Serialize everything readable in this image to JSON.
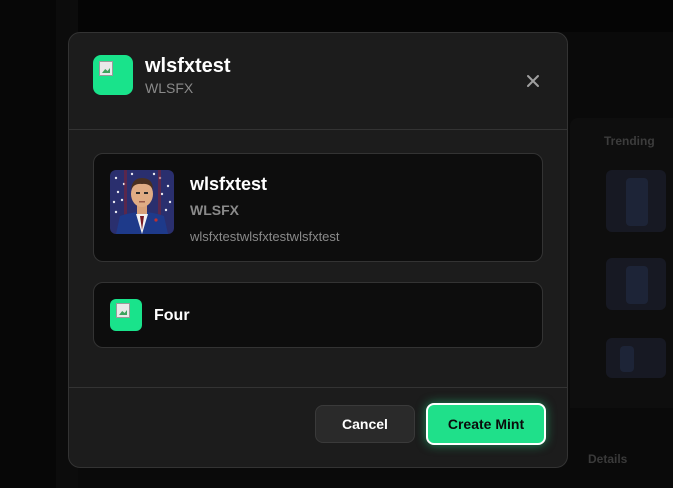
{
  "background": {
    "panel_title": "Trending",
    "bottom_label": "Details"
  },
  "modal": {
    "header": {
      "title": "wlsfxtest",
      "subtitle": "WLSFX",
      "logo_icon": "token-logo-broken-image-icon",
      "close_icon": "close-icon"
    },
    "token_card": {
      "name": "wlsfxtest",
      "symbol": "WLSFX",
      "description": "wlsfxtestwlsfxtestwlsfxtest"
    },
    "platform": {
      "label": "Four",
      "logo_icon": "platform-logo-broken-image-icon"
    },
    "footer": {
      "cancel_label": "Cancel",
      "create_label": "Create Mint"
    }
  },
  "colors": {
    "accent": "#1fe08a",
    "modal_bg": "#1c1c1c",
    "card_bg": "#0d0d0d",
    "border": "#333333",
    "muted_text": "#8a8a8a"
  }
}
